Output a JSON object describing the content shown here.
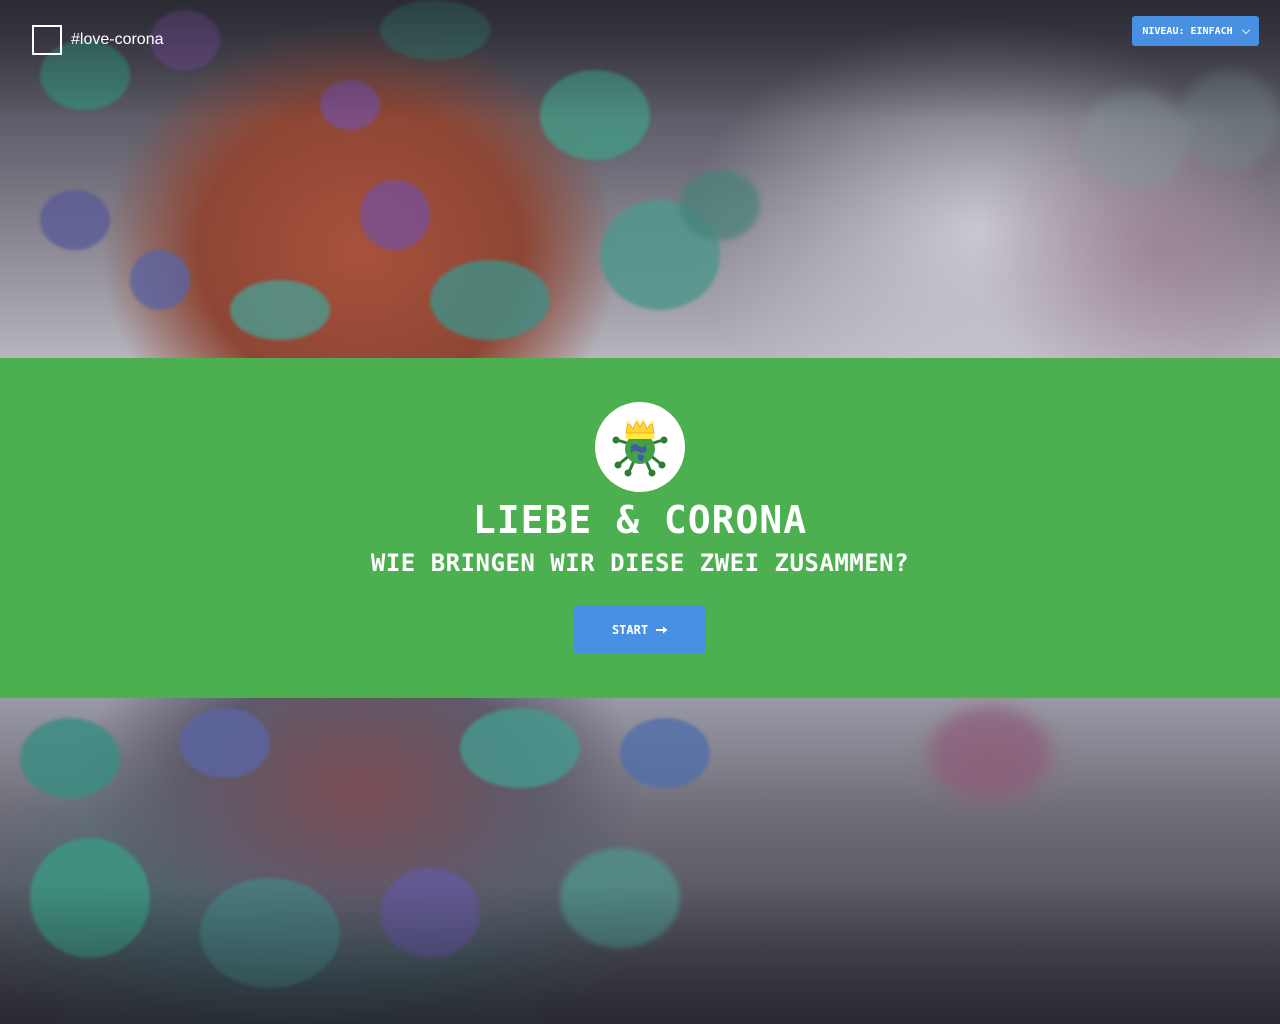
{
  "header": {
    "brand_label": "#love-corona",
    "level_button_label": "NIVEAU: EINFACH",
    "level_icon": "chevron-down-icon"
  },
  "hero": {
    "title": "LIEBE & CORONA",
    "subtitle": "WIE BRINGEN WIR DIESE ZWEI ZUSAMMEN?",
    "start_label": "START",
    "start_icon": "arrow-right-icon",
    "logo_icon": "crowned-virus-logo"
  },
  "colors": {
    "hero_green": "#4caf50",
    "button_blue": "#4a90e2",
    "text_white": "#ffffff"
  }
}
